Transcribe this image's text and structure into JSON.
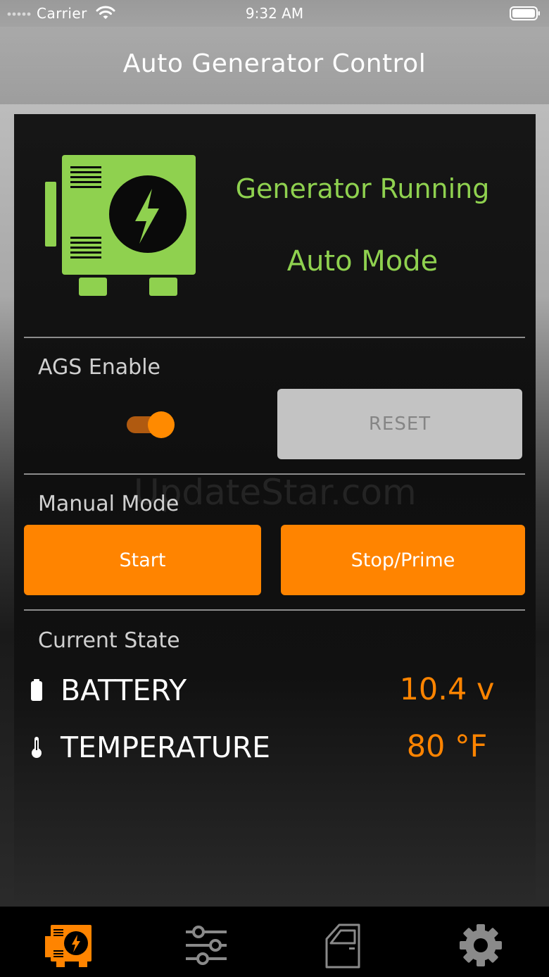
{
  "status_bar": {
    "carrier": "Carrier",
    "time": "9:32 AM"
  },
  "nav": {
    "title": "Auto Generator Control"
  },
  "generator": {
    "status": "Generator Running",
    "mode": "Auto Mode",
    "icon": "generator-icon",
    "color": "#8fd14f"
  },
  "ags": {
    "label": "AGS Enable",
    "enabled": true,
    "reset_label": "RESET"
  },
  "manual": {
    "label": "Manual Mode",
    "start_label": "Start",
    "stop_label": "Stop/Prime"
  },
  "watermark": "UpdateStar.com",
  "current_state": {
    "label": "Current State",
    "battery_label": "BATTERY",
    "battery_value": "10.4 v",
    "temperature_label": "TEMPERATURE",
    "temperature_value": "80 °F"
  },
  "tabs": [
    {
      "icon": "generator-tab-icon",
      "active": true
    },
    {
      "icon": "sliders-icon",
      "active": false
    },
    {
      "icon": "door-icon",
      "active": false
    },
    {
      "icon": "gear-icon",
      "active": false
    }
  ],
  "colors": {
    "accent": "#ff8400",
    "status_green": "#8fd14f",
    "inactive_icon": "#8a8a8a"
  }
}
